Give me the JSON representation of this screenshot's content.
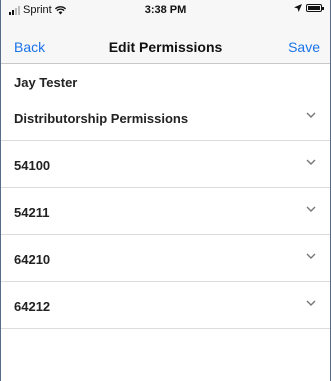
{
  "status_bar": {
    "carrier": "Sprint",
    "time": "3:38 PM"
  },
  "nav": {
    "back_label": "Back",
    "title": "Edit Permissions",
    "save_label": "Save"
  },
  "user": {
    "name": "Jay Tester"
  },
  "sections": [
    {
      "label": "Distributorship Permissions",
      "icon": "chevron-down-icon"
    },
    {
      "label": "54100",
      "icon": "chevron-down-icon"
    },
    {
      "label": "54211",
      "icon": "chevron-down-icon"
    },
    {
      "label": "64210",
      "icon": "chevron-down-icon"
    },
    {
      "label": "64212",
      "icon": "chevron-down-icon"
    }
  ],
  "colors": {
    "accent": "#1a73e8",
    "bar_background": "#f7f7f7",
    "divider": "#dcdcdc"
  }
}
